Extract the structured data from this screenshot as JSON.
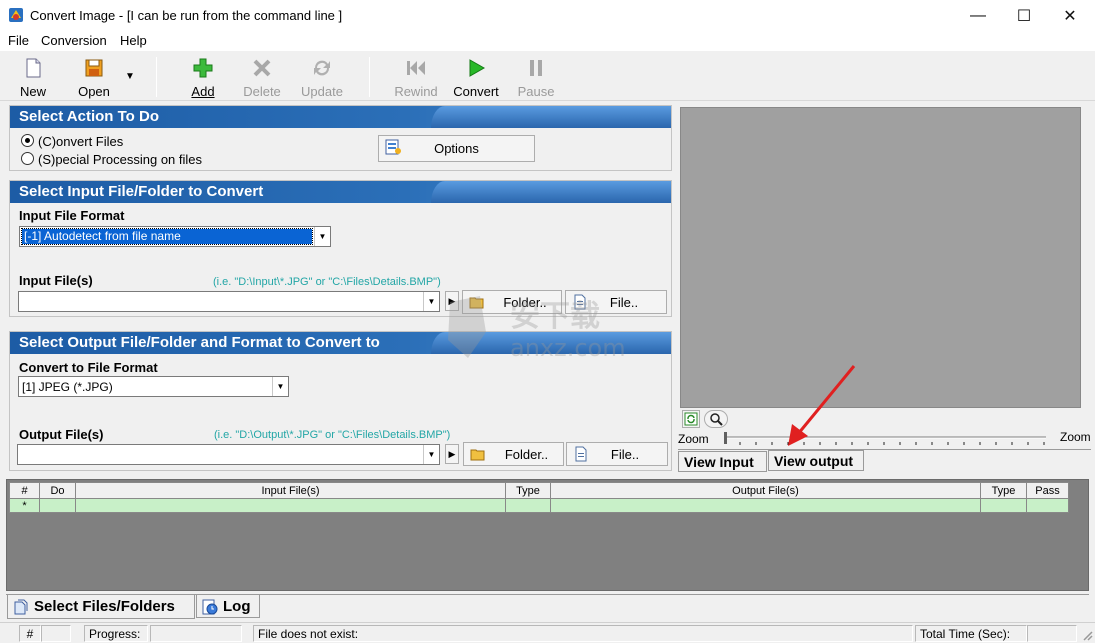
{
  "window": {
    "title": "Convert Image - [I can be run from the command line ]",
    "minimize": "—",
    "maximize": "☐",
    "close": "✕"
  },
  "menu": [
    "File",
    "Conversion",
    "Help"
  ],
  "toolbar": {
    "new": "New",
    "open": "Open",
    "add": "Add",
    "delete": "Delete",
    "update": "Update",
    "rewind": "Rewind",
    "convert": "Convert",
    "pause": "Pause"
  },
  "action_panel": {
    "header": "Select Action To Do",
    "option_convert": "(C)onvert Files",
    "option_special": "(S)pecial Processing on files",
    "selected": "convert",
    "options_button": "Options"
  },
  "input_panel": {
    "header": "Select Input File/Folder to Convert",
    "format_label": "Input File Format",
    "format_value": "[-1] Autodetect from file name",
    "files_label": "Input File(s)",
    "hint": "(i.e. \"D:\\Input\\*.JPG\"  or  \"C:\\Files\\Details.BMP\")",
    "files_value": "",
    "folder_button": "Folder..",
    "file_button": "File.."
  },
  "output_panel": {
    "header": "Select Output File/Folder and Format to Convert to",
    "format_label": "Convert to File Format",
    "format_value": "[1] JPEG (*.JPG)",
    "files_label": "Output File(s)",
    "hint": "(i.e. \"D:\\Output\\*.JPG\"  or  \"C:\\Files\\Details.BMP\")",
    "files_value": "",
    "folder_button": "Folder..",
    "file_button": "File.."
  },
  "preview": {
    "zoom_left": "Zoom",
    "zoom_right": "Zoom",
    "tab_input": "View Input",
    "tab_output": "View output"
  },
  "grid": {
    "columns": [
      "#",
      "Do",
      "Input File(s)",
      "Type",
      "Output File(s)",
      "Type",
      "Pass"
    ],
    "rows": [
      [
        "*",
        "",
        "",
        "",
        "",
        "",
        ""
      ]
    ]
  },
  "bottom_tabs": [
    "Select Files/Folders",
    "Log"
  ],
  "status": {
    "hash": "#",
    "progress_label": "Progress:",
    "message": "File does not exist:",
    "total_time_label": "Total Time (Sec):"
  },
  "watermark": {
    "text_cn": "安下载",
    "text_en": "anxz.com"
  },
  "colors": {
    "header_blue": "#1d5ca5",
    "grid_row": "#c8f0c8",
    "preview_bg": "#a0a0a0",
    "hint_teal": "#23a6a6",
    "annotation_arrow": "#e02020"
  }
}
